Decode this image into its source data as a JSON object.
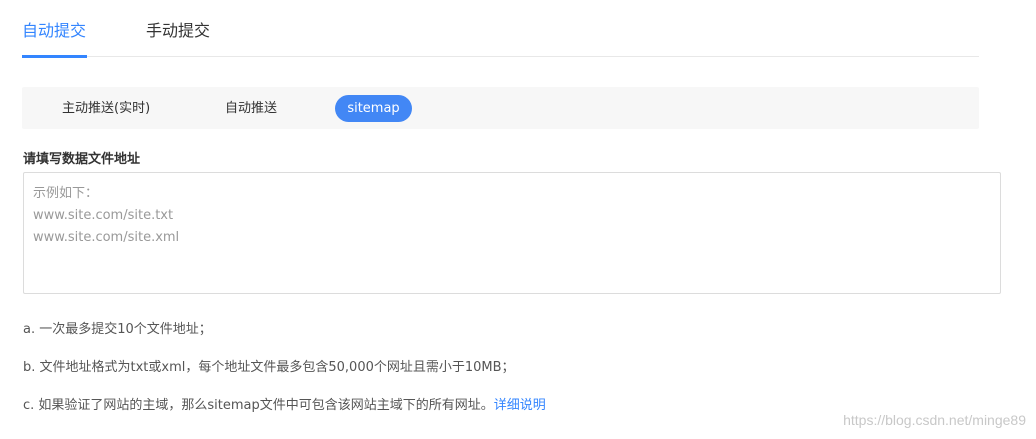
{
  "top_tabs": {
    "auto_label": "自动提交",
    "manual_label": "手动提交",
    "active": "自动提交"
  },
  "sub_tabs": {
    "items": [
      "主动推送(实时)",
      "自动推送",
      "sitemap"
    ],
    "active": "sitemap"
  },
  "form": {
    "label": "请填写数据文件地址",
    "placeholder": "示例如下：\nwww.site.com/site.txt\nwww.site.com/site.xml",
    "value": ""
  },
  "notes": {
    "a": "a. 一次最多提交10个文件地址；",
    "b": "b. 文件地址格式为txt或xml，每个地址文件最多包含50,000个网址且需小于10MB；",
    "c_text": "c. 如果验证了网站的主域，那么sitemap文件中可包含该网站主域下的所有网址。",
    "c_link": "详细说明"
  },
  "watermark": "https://blog.csdn.net/minge89",
  "colors": {
    "accent": "#3385ff",
    "pill": "#4287f5",
    "bar_bg": "#f7f7f7"
  }
}
